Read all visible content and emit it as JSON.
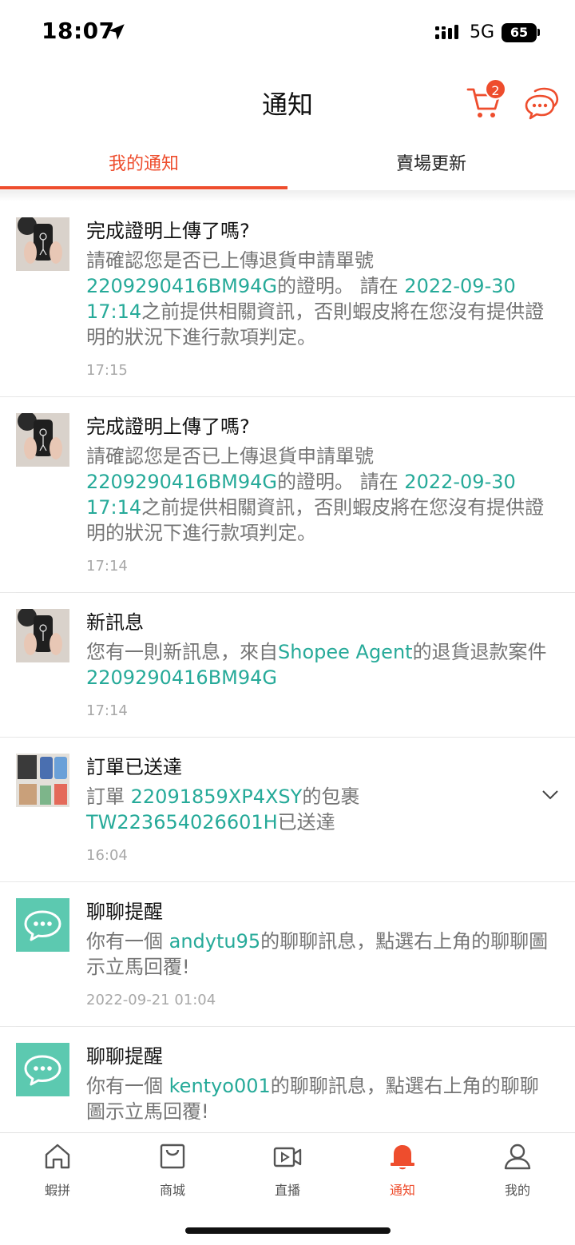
{
  "status": {
    "time": "18:07",
    "network": "5G",
    "battery": "65"
  },
  "header": {
    "title": "通知",
    "cart_badge": "2"
  },
  "tabs": [
    {
      "label": "我的通知",
      "active": true
    },
    {
      "label": "賣場更新",
      "active": false
    }
  ],
  "notifications": [
    {
      "title": "完成證明上傳了嗎?",
      "parts": [
        "請確認您是否已上傳退貨申請單號",
        "2209290416BM94G",
        "的證明。 請在",
        "2022-09-30 17:14",
        "之前提供相關資訊，否則蝦皮將在您沒有提供證明的狀況下進行款項判定。"
      ],
      "time": "17:15"
    },
    {
      "title": "完成證明上傳了嗎?",
      "parts": [
        "請確認您是否已上傳退貨申請單號",
        "2209290416BM94G",
        "的證明。 請在",
        "2022-09-30 17:14",
        "之前提供相關資訊，否則蝦皮將在您沒有提供證明的狀況下進行款項判定。"
      ],
      "time": "17:14"
    },
    {
      "title": "新訊息",
      "parts": [
        "您有一則新訊息，來自",
        "Shopee Agent",
        "的退貨退款案件",
        "2209290416BM94G",
        ""
      ],
      "time": "17:14"
    },
    {
      "title": "訂單已送達",
      "parts": [
        "訂單",
        "22091859XP4XSY",
        "的包裹",
        "TW223654026601H",
        "已送達"
      ],
      "time": "16:04"
    },
    {
      "title": "聊聊提醒",
      "parts": [
        "你有一個",
        "andytu95",
        "的聊聊訊息，點選右上角的聊聊圖示立馬回覆!",
        "",
        ""
      ],
      "time": "2022-09-21 01:04"
    },
    {
      "title": "聊聊提醒",
      "parts": [
        "你有一個",
        "kentyo001",
        "的聊聊訊息，點選右上角的聊聊圖示立馬回覆!",
        "",
        ""
      ],
      "time": ""
    }
  ],
  "bottom_nav": [
    {
      "label": "蝦拼",
      "icon": "home-icon"
    },
    {
      "label": "商城",
      "icon": "mall-bag-icon"
    },
    {
      "label": "直播",
      "icon": "live-video-icon"
    },
    {
      "label": "通知",
      "icon": "bell-icon",
      "active": true
    },
    {
      "label": "我的",
      "icon": "profile-icon"
    }
  ],
  "colors": {
    "accent": "#ee4d2d",
    "link": "#26aa99"
  }
}
